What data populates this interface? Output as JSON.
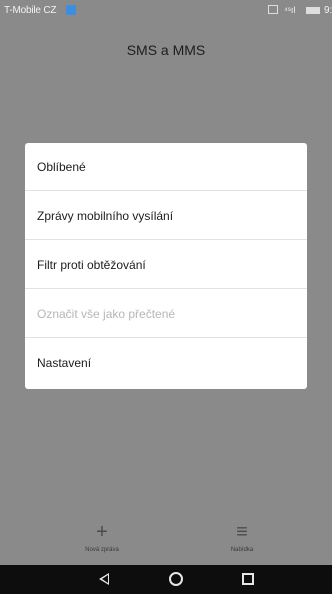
{
  "status_bar": {
    "carrier": "T-Mobile CZ",
    "signal": "⁴ˢıl",
    "time": "9:3"
  },
  "app": {
    "title": "SMS a MMS"
  },
  "menu": {
    "items": [
      {
        "label": "Oblíbené",
        "enabled": true
      },
      {
        "label": "Zprávy mobilního vysílání",
        "enabled": true
      },
      {
        "label": "Filtr proti obtěžování",
        "enabled": true
      },
      {
        "label": "Označit vše jako přečtené",
        "enabled": false
      },
      {
        "label": "Nastavení",
        "enabled": true
      }
    ]
  },
  "bottom_bar": {
    "new_message": {
      "icon": "plus-icon",
      "glyph": "+",
      "label": "Nová zpráva"
    },
    "menu": {
      "icon": "menu-icon",
      "glyph": "≡",
      "label": "Nabídka"
    }
  },
  "nav_bar": {
    "back": "back-icon",
    "home": "home-icon",
    "recents": "recents-icon"
  },
  "colors": {
    "dim_background": "#8a8a8a",
    "card": "#ffffff",
    "disabled_text": "#b6b6b6",
    "nav_bar": "#0d0d0d"
  }
}
